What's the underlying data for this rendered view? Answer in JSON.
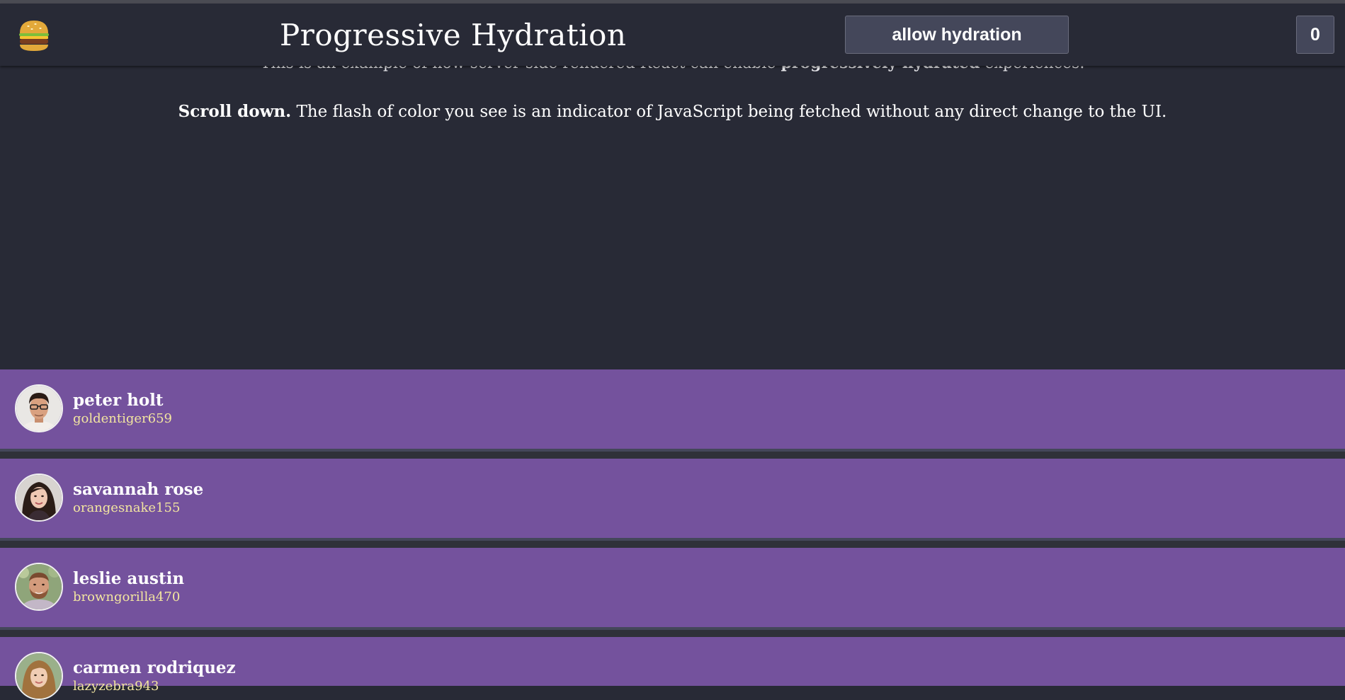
{
  "header": {
    "logo_icon": "hamburger-icon",
    "title": "Progressive Hydration",
    "hydrate_button_label": "allow hydration",
    "counter_value": "0"
  },
  "intro": {
    "line_start": "This is an example of how server-side rendered React can enable ",
    "line_bold": "progressively hydrated",
    "line_end": " experiences."
  },
  "scroll_note": {
    "bold": "Scroll down.",
    "text": " The flash of color you see is an indicator of JavaScript being fetched without any direct change to the UI."
  },
  "users": [
    {
      "name": "peter holt",
      "username": "goldentiger659"
    },
    {
      "name": "savannah rose",
      "username": "orangesnake155"
    },
    {
      "name": "leslie austin",
      "username": "browngorilla470"
    },
    {
      "name": "carmen rodriquez",
      "username": "lazyzebra943"
    }
  ],
  "colors": {
    "background": "#282a36",
    "row_background": "#74529d",
    "button_background": "#44475a",
    "username_color": "#f3e6a0"
  }
}
